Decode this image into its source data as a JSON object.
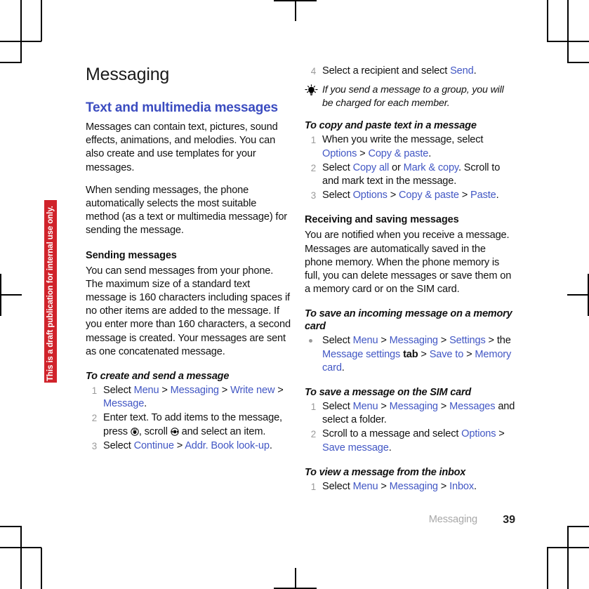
{
  "document": {
    "title": "Messaging",
    "draft_banner": "This is a draft publication for internal use only.",
    "footer_section": "Messaging",
    "page_number": "39",
    "accent_link_color": "#4257c4",
    "heading_color": "#3b4cc0",
    "banner_color": "#d0232b"
  },
  "left_column": {
    "section_heading": "Text and multimedia messages",
    "intro_para_1": "Messages can contain text, pictures, sound effects, animations, and melodies. You can also create and use templates for your messages.",
    "intro_para_2": "When sending messages, the phone automatically selects the most suitable method (as a text or multimedia message) for sending the message.",
    "sending_heading": "Sending messages",
    "sending_para": "You can send messages from your phone. The maximum size of a standard text message is 160 characters including spaces if no other items are added to the message. If you enter more than 160 characters, a second message is created. Your messages are sent as one concatenated message.",
    "task_create_title": "To create and send a message",
    "steps": [
      {
        "num": "1",
        "parts": [
          {
            "t": "Select ",
            "s": "plain"
          },
          {
            "t": "Menu",
            "s": "link"
          },
          {
            "t": " > ",
            "s": "plain"
          },
          {
            "t": "Messaging",
            "s": "link"
          },
          {
            "t": " > ",
            "s": "plain"
          },
          {
            "t": "Write new",
            "s": "link"
          },
          {
            "t": " > ",
            "s": "plain"
          },
          {
            "t": "Message",
            "s": "link"
          },
          {
            "t": ".",
            "s": "plain"
          }
        ]
      },
      {
        "num": "2",
        "parts": [
          {
            "t": "Enter text. To add items to the message, press ",
            "s": "plain"
          },
          {
            "t": "",
            "s": "joystick-press"
          },
          {
            "t": ", scroll ",
            "s": "plain"
          },
          {
            "t": "",
            "s": "joystick-scroll"
          },
          {
            "t": " and select an item.",
            "s": "plain"
          }
        ]
      },
      {
        "num": "3",
        "parts": [
          {
            "t": "Select ",
            "s": "plain"
          },
          {
            "t": "Continue",
            "s": "link"
          },
          {
            "t": " > ",
            "s": "plain"
          },
          {
            "t": "Addr. Book look-up",
            "s": "link"
          },
          {
            "t": ".",
            "s": "plain"
          }
        ]
      }
    ]
  },
  "right_column": {
    "step_4": {
      "num": "4",
      "parts": [
        {
          "t": "Select a recipient and select ",
          "s": "plain"
        },
        {
          "t": "Send",
          "s": "link"
        },
        {
          "t": ".",
          "s": "plain"
        }
      ]
    },
    "tip_icon": "lightbulb-icon",
    "tip_text": "If you send a message to a group, you will be charged for each member.",
    "task_copy_title": "To copy and paste text in a message",
    "copy_steps": [
      {
        "num": "1",
        "parts": [
          {
            "t": "When you write the message, select ",
            "s": "plain"
          },
          {
            "t": "Options",
            "s": "link"
          },
          {
            "t": " > ",
            "s": "plain"
          },
          {
            "t": "Copy & paste",
            "s": "link"
          },
          {
            "t": ".",
            "s": "plain"
          }
        ]
      },
      {
        "num": "2",
        "parts": [
          {
            "t": "Select ",
            "s": "plain"
          },
          {
            "t": "Copy all",
            "s": "link"
          },
          {
            "t": " or ",
            "s": "plain"
          },
          {
            "t": "Mark & copy",
            "s": "link"
          },
          {
            "t": ". Scroll to and mark text in the message.",
            "s": "plain"
          }
        ]
      },
      {
        "num": "3",
        "parts": [
          {
            "t": "Select ",
            "s": "plain"
          },
          {
            "t": "Options",
            "s": "link"
          },
          {
            "t": " > ",
            "s": "plain"
          },
          {
            "t": "Copy & paste",
            "s": "link"
          },
          {
            "t": " > ",
            "s": "plain"
          },
          {
            "t": "Paste",
            "s": "link"
          },
          {
            "t": ".",
            "s": "plain"
          }
        ]
      }
    ],
    "receiving_heading": "Receiving and saving messages",
    "receiving_para": "You are notified when you receive a message. Messages are automatically saved in the phone memory. When the phone memory is full, you can delete messages or save them on a memory card or on the SIM card.",
    "task_memcard_title": "To save an incoming message on a memory card",
    "memcard_step": {
      "bullet": "•",
      "parts": [
        {
          "t": "Select ",
          "s": "plain"
        },
        {
          "t": "Menu",
          "s": "link"
        },
        {
          "t": " > ",
          "s": "plain"
        },
        {
          "t": "Messaging",
          "s": "link"
        },
        {
          "t": " > ",
          "s": "plain"
        },
        {
          "t": "Settings",
          "s": "link"
        },
        {
          "t": " > the ",
          "s": "plain"
        },
        {
          "t": "Message settings",
          "s": "link"
        },
        {
          "t": " tab",
          "s": "bold"
        },
        {
          "t": " > ",
          "s": "plain"
        },
        {
          "t": "Save to",
          "s": "link"
        },
        {
          "t": " > ",
          "s": "plain"
        },
        {
          "t": "Memory card",
          "s": "link"
        },
        {
          "t": ".",
          "s": "plain"
        }
      ]
    },
    "task_sim_title": "To save a message on the SIM card",
    "sim_steps": [
      {
        "num": "1",
        "parts": [
          {
            "t": "Select ",
            "s": "plain"
          },
          {
            "t": "Menu",
            "s": "link"
          },
          {
            "t": " > ",
            "s": "plain"
          },
          {
            "t": "Messaging",
            "s": "link"
          },
          {
            "t": " > ",
            "s": "plain"
          },
          {
            "t": "Messages",
            "s": "link"
          },
          {
            "t": " and select a folder.",
            "s": "plain"
          }
        ]
      },
      {
        "num": "2",
        "parts": [
          {
            "t": "Scroll to a message and select ",
            "s": "plain"
          },
          {
            "t": "Options",
            "s": "link"
          },
          {
            "t": " > ",
            "s": "plain"
          },
          {
            "t": "Save message",
            "s": "link"
          },
          {
            "t": ".",
            "s": "plain"
          }
        ]
      }
    ],
    "task_inbox_title": "To view a message from the inbox",
    "inbox_steps": [
      {
        "num": "1",
        "parts": [
          {
            "t": "Select ",
            "s": "plain"
          },
          {
            "t": "Menu",
            "s": "link"
          },
          {
            "t": " > ",
            "s": "plain"
          },
          {
            "t": "Messaging",
            "s": "link"
          },
          {
            "t": " > ",
            "s": "plain"
          },
          {
            "t": "Inbox",
            "s": "link"
          },
          {
            "t": ".",
            "s": "plain"
          }
        ]
      }
    ]
  }
}
